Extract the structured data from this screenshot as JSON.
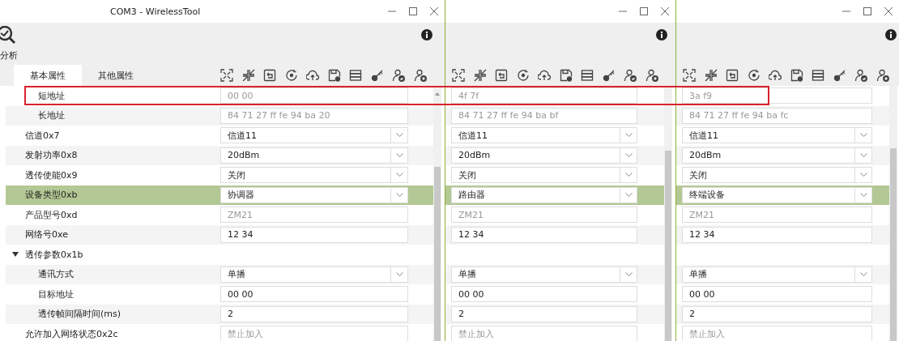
{
  "window": {
    "title": "COM3 - WirelessTool",
    "tool_label": "分析",
    "tabs": [
      {
        "label": "基本属性",
        "selected": true
      },
      {
        "label": "其他属性",
        "selected": false
      }
    ]
  },
  "properties": [
    {
      "kind": "continued",
      "children": [
        {
          "label": "短地址",
          "kind": "readonly",
          "selected": false,
          "values": [
            "00 00",
            "4f 7f",
            "3a f9"
          ]
        },
        {
          "label": "长地址",
          "kind": "readonly",
          "selected": false,
          "values": [
            "84 71 27 ff fe 94 ba 20",
            "84 71 27 ff fe 94 ba bf",
            "84 71 27 ff fe 94 ba fc"
          ]
        }
      ]
    },
    {
      "label": "信道0x7",
      "kind": "select",
      "selected": false,
      "values": [
        "信道11",
        "信道11",
        "信道11"
      ]
    },
    {
      "label": "发射功率0x8",
      "kind": "select",
      "selected": false,
      "values": [
        "20dBm",
        "20dBm",
        "20dBm"
      ]
    },
    {
      "label": "透传使能0x9",
      "kind": "select",
      "selected": false,
      "values": [
        "关闭",
        "关闭",
        "关闭"
      ]
    },
    {
      "label": "设备类型0xb",
      "kind": "select",
      "selected": true,
      "values": [
        "协调器",
        "路由器",
        "终端设备"
      ]
    },
    {
      "label": "产品型号0xd",
      "kind": "readonly",
      "selected": false,
      "values": [
        "ZM21",
        "ZM21",
        "ZM21"
      ]
    },
    {
      "label": "网络号0xe",
      "kind": "input",
      "selected": false,
      "values": [
        "12 34",
        "12 34",
        "12 34"
      ]
    },
    {
      "label": "透传参数0x1b",
      "kind": "group",
      "expanded": true,
      "selected": false,
      "children": [
        {
          "label": "通讯方式",
          "kind": "select",
          "selected": false,
          "values": [
            "单播",
            "单播",
            "单播"
          ]
        },
        {
          "label": "目标地址",
          "kind": "input",
          "selected": false,
          "values": [
            "00 00",
            "00 00",
            "00 00"
          ]
        },
        {
          "label": "透传帧间隔时间(ms)",
          "kind": "input",
          "selected": false,
          "values": [
            "2",
            "2",
            "2"
          ]
        }
      ]
    },
    {
      "label": "允许加入网络状态0x2c",
      "kind": "readonly",
      "selected": false,
      "values": [
        "禁止加入",
        "禁止加入",
        "禁止加入"
      ]
    }
  ]
}
